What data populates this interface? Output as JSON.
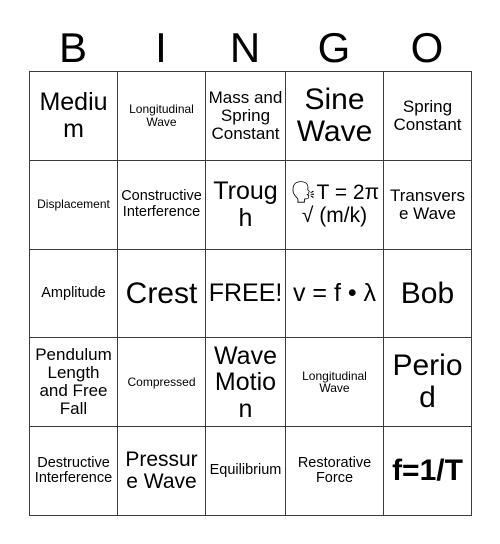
{
  "card": {
    "title": "BINGO Card",
    "headers": [
      "B",
      "I",
      "N",
      "G",
      "O"
    ],
    "rows": [
      [
        {
          "text": "Medium",
          "size": "fs-xl"
        },
        {
          "text": "Longitudinal Wave",
          "size": "fs-xs"
        },
        {
          "text": "Mass and Spring Constant",
          "size": "fs-md"
        },
        {
          "text": "Sine Wave",
          "size": "fs-xxl"
        },
        {
          "text": "Spring Constant",
          "size": "fs-md"
        }
      ],
      [
        {
          "text": "Displacement",
          "size": "fs-xs"
        },
        {
          "text": "Constructive Interference",
          "size": "fs-sm"
        },
        {
          "text": "Trough",
          "size": "fs-xl"
        },
        {
          "text": "🗣T = 2π √ (m/k)",
          "size": "fs-lg"
        },
        {
          "text": "Transverse Wave",
          "size": "fs-md"
        }
      ],
      [
        {
          "text": "Amplitude",
          "size": "fs-sm"
        },
        {
          "text": "Crest",
          "size": "fs-xxl"
        },
        {
          "text": "FREE!",
          "size": "fs-xl"
        },
        {
          "text": "v = f • λ",
          "size": "fs-xl"
        },
        {
          "text": "Bob",
          "size": "fs-xxl"
        }
      ],
      [
        {
          "text": "Pendulum Length and Free Fall",
          "size": "fs-md"
        },
        {
          "text": "Compressed",
          "size": "fs-xs"
        },
        {
          "text": "Wave Motion",
          "size": "fs-xl"
        },
        {
          "text": "Longitudinal Wave",
          "size": "fs-xs"
        },
        {
          "text": "Period",
          "size": "fs-xxl"
        }
      ],
      [
        {
          "text": "Destructive Interference",
          "size": "fs-sm"
        },
        {
          "text": "Pressure Wave",
          "size": "fs-lg"
        },
        {
          "text": "Equilibrium",
          "size": "fs-sm"
        },
        {
          "text": "Restorative Force",
          "size": "fs-sm"
        },
        {
          "text": "f=1/T",
          "size": "fs-xxl bold"
        }
      ]
    ]
  },
  "colors": {
    "background": "#ffffff",
    "border": "#3b3b3b",
    "text": "#000000"
  }
}
